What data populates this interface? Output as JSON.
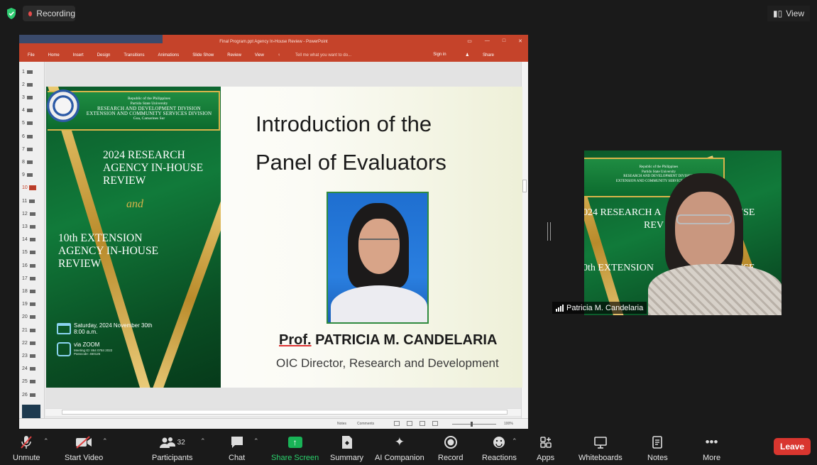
{
  "topbar": {
    "recording_label": "Recording",
    "view_label": "View"
  },
  "ppt": {
    "window_title": "Final Program.ppt Agency In-House Review - PowerPoint",
    "tabs": [
      "File",
      "Home",
      "Insert",
      "Design",
      "Transitions",
      "Animations",
      "Slide Show",
      "Review",
      "View"
    ],
    "tell_me": "Tell me what you want to do...",
    "sign_in": "Sign in",
    "share": "Share",
    "slide_numbers": [
      "1",
      "2",
      "3",
      "4",
      "5",
      "6",
      "7",
      "8",
      "9",
      "10",
      "11",
      "12",
      "13",
      "14",
      "15",
      "16",
      "17",
      "18",
      "19",
      "20",
      "21",
      "22",
      "23",
      "24",
      "25",
      "26"
    ],
    "active_slide": "10",
    "status": {
      "notes": "Notes",
      "comments": "Comments",
      "zoom": "100%"
    }
  },
  "slide": {
    "banner_line1": "Republic of the Philippines",
    "banner_line2": "Partido State University",
    "banner_line3": "RESEARCH AND DEVELOPMENT DIVISION",
    "banner_line4": "EXTENSION AND COMMUNITY SERVICES DIVISION",
    "banner_line5": "Goa, Camarines Sur",
    "title1": "2024 RESEARCH AGENCY IN-HOUSE REVIEW",
    "and": "and",
    "title2": "10th EXTENSION AGENCY IN-HOUSE REVIEW",
    "date_line1": "Saturday, 2024 November 30th",
    "date_line2": "8:00 a.m.",
    "via": "via ZOOM",
    "meeting_id": "Meeting ID: 864 0784 2022",
    "passcode": "Passcode: 450125",
    "heading_line1": "Introduction of the",
    "heading_line2": "Panel of  Evaluators",
    "name_prefix": "Prof.",
    "name": "PATRICIA M. CANDELARIA",
    "position": "OIC Director, Research and Development"
  },
  "video_tile": {
    "participant_name": "Patricia M. Candelaria",
    "bg_text1": "024 RESEARCH A",
    "bg_text1_end": "USE",
    "bg_text1b": "REV",
    "bg_text2": "0th EXTENSION",
    "bg_text2_end": "USE"
  },
  "toolbar": {
    "unmute": "Unmute",
    "start_video": "Start Video",
    "participants": "Participants",
    "participant_count": "32",
    "chat": "Chat",
    "share_screen": "Share Screen",
    "summary": "Summary",
    "ai_companion": "AI Companion",
    "record": "Record",
    "reactions": "Reactions",
    "apps": "Apps",
    "whiteboards": "Whiteboards",
    "notes": "Notes",
    "more": "More",
    "leave": "Leave"
  },
  "colors": {
    "share_green": "#19b357",
    "leave_red": "#d9362f",
    "ppt_red": "#c5432a",
    "recording_dot": "#e54b4b"
  }
}
